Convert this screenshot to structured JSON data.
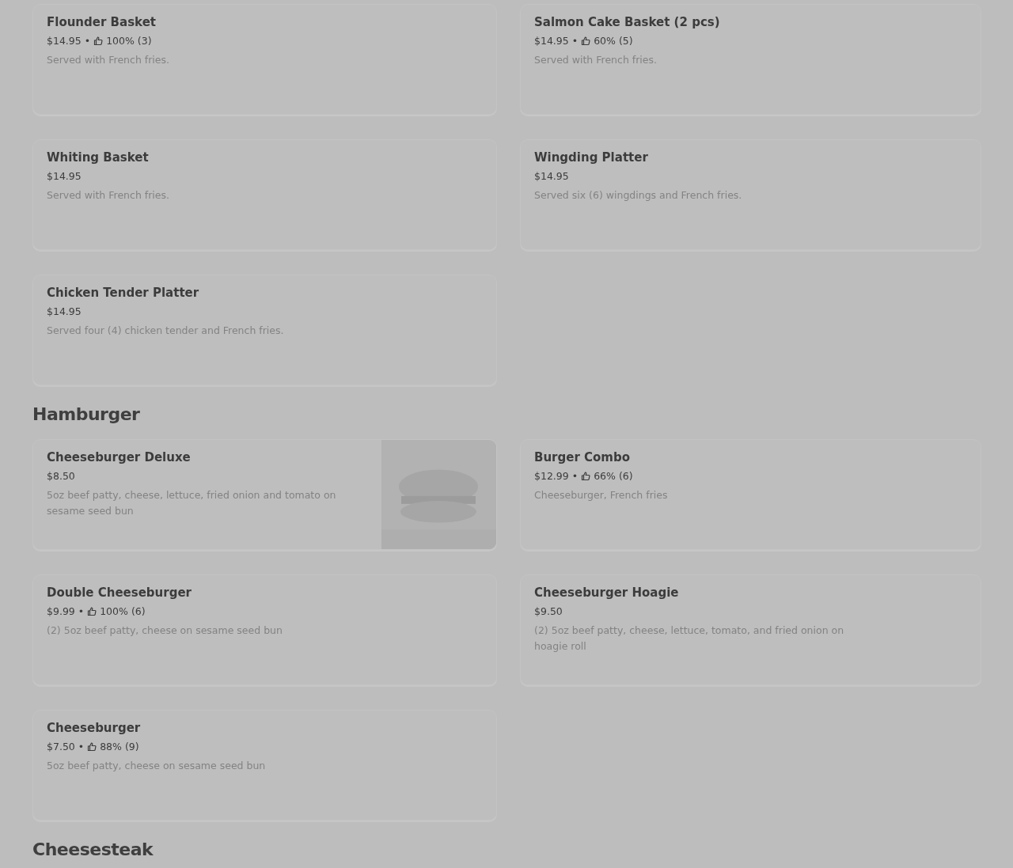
{
  "sections": [
    {
      "items": [
        {
          "name": "Flounder Basket",
          "price": "$14.95",
          "separator": "•",
          "rating": "100% (3)",
          "description": "Served with French fries."
        },
        {
          "name": "Salmon Cake Basket (2 pcs)",
          "price": "$14.95",
          "separator": "•",
          "rating": "60% (5)",
          "description": "Served with French fries."
        },
        {
          "name": "Whiting Basket",
          "price": "$14.95",
          "description": "Served with French fries."
        },
        {
          "name": "Wingding Platter",
          "price": "$14.95",
          "description": "Served six (6) wingdings and French fries."
        },
        {
          "name": "Chicken Tender Platter",
          "price": "$14.95",
          "description": "Served four (4) chicken tender and French fries."
        }
      ]
    },
    {
      "heading": "Hamburger",
      "items": [
        {
          "name": "Cheeseburger Deluxe",
          "price": "$8.50",
          "description": "5oz beef patty, cheese, lettuce, fried onion and tomato on sesame seed bun"
        },
        {
          "name": "Burger Combo",
          "price": "$12.99",
          "separator": "•",
          "rating": "66% (6)",
          "description": "Cheeseburger, French fries"
        },
        {
          "name": "Double Cheeseburger",
          "price": "$9.99",
          "separator": "•",
          "rating": "100% (6)",
          "description": "(2) 5oz beef patty, cheese on sesame seed bun"
        },
        {
          "name": "Cheeseburger Hoagie",
          "price": "$9.50",
          "description": "(2) 5oz beef patty, cheese, lettuce, tomato, and fried onion on hoagie roll"
        },
        {
          "name": "Cheeseburger",
          "price": "$7.50",
          "separator": "•",
          "rating": "88% (9)",
          "description": "5oz beef patty, cheese on sesame seed bun"
        }
      ]
    },
    {
      "heading": "Cheesesteak"
    }
  ]
}
